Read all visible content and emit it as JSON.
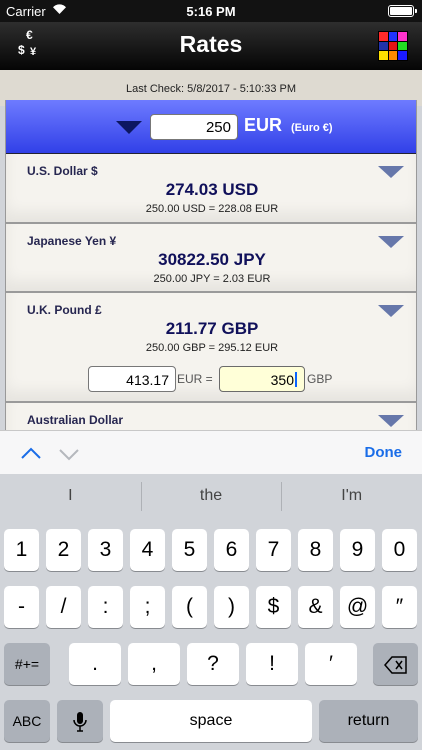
{
  "status_bar": {
    "carrier": "Carrier",
    "wifi_icon": "wifi-icon",
    "time": "5:16 PM",
    "battery_icon": "battery-icon"
  },
  "nav": {
    "title": "Rates",
    "left_icon": "currency-switch-icon",
    "left_icon_glyphs": {
      "euro": "€",
      "dollar": "$",
      "yen": "¥"
    },
    "right_icon": "color-grid-icon",
    "color_grid": [
      "#ff2a2a",
      "#2233ff",
      "#ff33cc",
      "#2233aa",
      "#e51414",
      "#22dd22",
      "#ffe000",
      "#ff8a00",
      "#1a1aff"
    ]
  },
  "last_check": "Last Check: 5/8/2017 - 5:10:33 PM",
  "base": {
    "amount": "250",
    "code": "EUR",
    "name": "(Euro €)"
  },
  "currencies": [
    {
      "name": "U.S. Dollar $",
      "amount": "274.03 USD",
      "inverse": "250.00 USD = 228.08 EUR"
    },
    {
      "name": "Japanese Yen ¥",
      "amount": "30822.50 JPY",
      "inverse": "250.00 JPY = 2.03 EUR"
    },
    {
      "name": "U.K. Pound £",
      "amount": "211.77 GBP",
      "inverse": "250.00 GBP = 295.12 EUR"
    },
    {
      "name": "Australian Dollar",
      "amount": "",
      "inverse": ""
    }
  ],
  "calculator": {
    "left_value": "413.17",
    "left_code": "EUR =",
    "right_value": "350",
    "right_code": "GBP"
  },
  "accessory": {
    "done": "Done"
  },
  "predictions": [
    "I",
    "the",
    "I'm"
  ],
  "keyboard": {
    "row1": [
      "1",
      "2",
      "3",
      "4",
      "5",
      "6",
      "7",
      "8",
      "9",
      "0"
    ],
    "row2": [
      "-",
      "/",
      ":",
      ";",
      "(",
      ")",
      "$",
      "&",
      "@",
      "″"
    ],
    "row3": [
      ".",
      ",",
      "?",
      "!",
      "′"
    ],
    "shift_symbols": "#+=",
    "abc": "ABC",
    "space": "space",
    "return": "return"
  }
}
